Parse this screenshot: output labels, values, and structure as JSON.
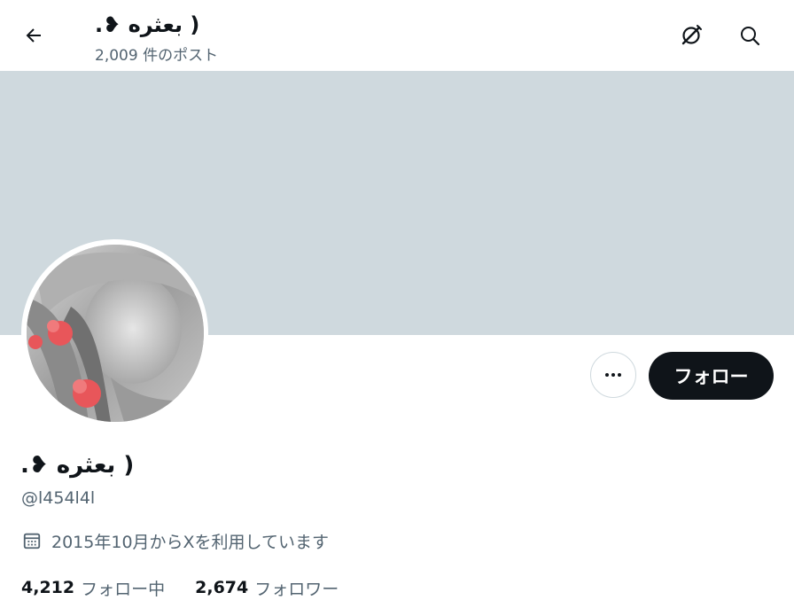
{
  "header": {
    "title": "( بعثره ❥.",
    "post_count": "2,009 件のポスト"
  },
  "icons": {
    "back": "arrow-left-icon",
    "grok": "grok-icon",
    "search": "search-icon",
    "more": "more-horizontal-icon",
    "calendar": "calendar-icon"
  },
  "banner": {
    "color": "#cfd9de"
  },
  "profile": {
    "display_name": "( بعثره ❥.",
    "handle": "@l454l4l",
    "joined": "2015年10月からXを利用しています"
  },
  "actions": {
    "follow_label": "フォロー"
  },
  "stats": {
    "following_count": "4,212",
    "following_label": "フォロー中",
    "followers_count": "2,674",
    "followers_label": "フォロワー"
  },
  "colors": {
    "text": "#0f1419",
    "secondary": "#536471",
    "button": "#0f1419"
  }
}
